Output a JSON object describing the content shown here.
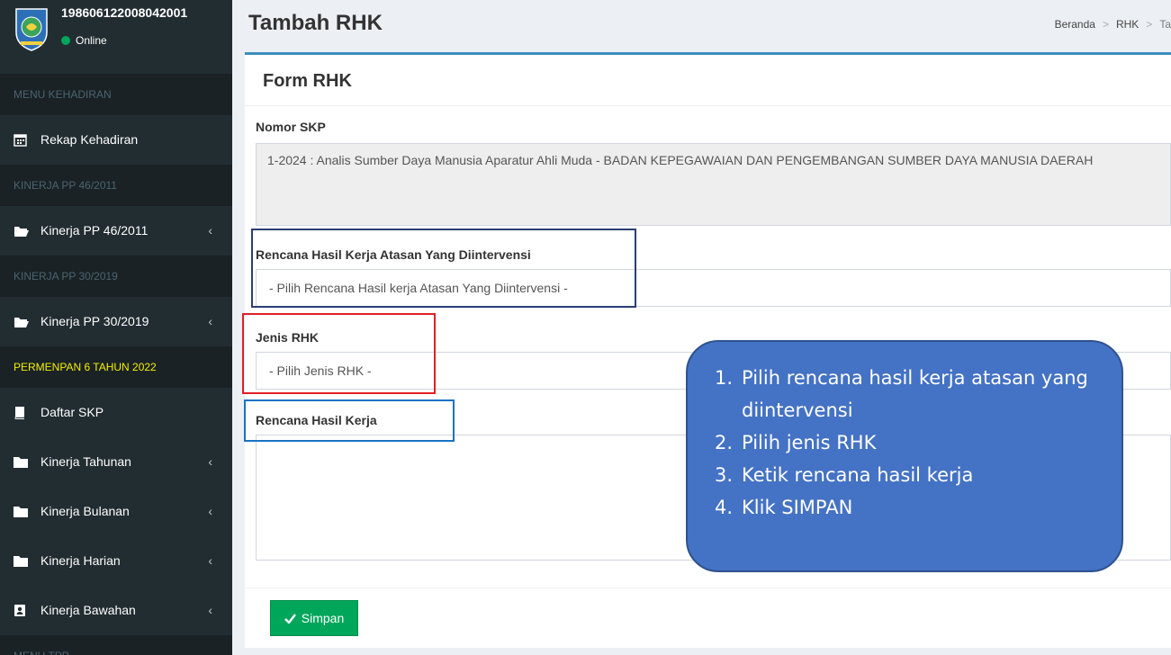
{
  "user": {
    "id": "198606122008042001",
    "status": "Online"
  },
  "sidebar": {
    "items": [
      {
        "type": "header",
        "label": "MENU KEHADIRAN"
      },
      {
        "type": "item",
        "label": "Rekap Kehadiran",
        "icon": "calendar-icon"
      },
      {
        "type": "header",
        "label": "KINERJA PP 46/2011"
      },
      {
        "type": "item",
        "label": "Kinerja PP 46/2011",
        "icon": "folder-open-icon",
        "chevron": "‹"
      },
      {
        "type": "header",
        "label": "KINERJA PP 30/2019"
      },
      {
        "type": "item",
        "label": "Kinerja PP 30/2019",
        "icon": "folder-open-icon",
        "chevron": "‹"
      },
      {
        "type": "header",
        "label": "PERMENPAN 6 TAHUN 2022"
      },
      {
        "type": "item",
        "label": "Daftar SKP",
        "icon": "book-icon"
      },
      {
        "type": "item",
        "label": "Kinerja Tahunan",
        "icon": "folder-icon",
        "chevron": "‹"
      },
      {
        "type": "item",
        "label": "Kinerja Bulanan",
        "icon": "folder-icon",
        "chevron": "‹"
      },
      {
        "type": "item",
        "label": "Kinerja Harian",
        "icon": "folder-icon",
        "chevron": "‹"
      },
      {
        "type": "item",
        "label": "Kinerja Bawahan",
        "icon": "contact-book-icon",
        "chevron": "‹"
      },
      {
        "type": "header",
        "label": "MENU TPP"
      }
    ]
  },
  "page": {
    "title": "Tambah RHK",
    "breadcrumb": [
      "Beranda",
      "RHK",
      "Ta"
    ]
  },
  "form": {
    "title": "Form RHK",
    "nomor_skp_label": "Nomor SKP",
    "nomor_skp_value": "1-2024 : Analis Sumber Daya Manusia Aparatur Ahli Muda - BADAN KEPEGAWAIAN DAN PENGEMBANGAN SUMBER DAYA MANUSIA DAERAH",
    "rhk_atasan_label": "Rencana Hasil Kerja Atasan Yang Diintervensi",
    "rhk_atasan_placeholder": "- Pilih Rencana Hasil kerja Atasan Yang Diintervensi -",
    "jenis_rhk_label": "Jenis RHK",
    "jenis_rhk_placeholder": "- Pilih Jenis RHK -",
    "rhk_label": "Rencana Hasil Kerja",
    "rhk_value": "",
    "save_label": "Simpan"
  },
  "callout": {
    "steps": [
      "Pilih rencana hasil kerja atasan yang diintervensi",
      "Pilih jenis RHK",
      "Ketik rencana hasil kerja",
      "Klik SIMPAN"
    ]
  },
  "colors": {
    "sidebar_bg": "#222d32",
    "accent": "#3c8dbc",
    "save_button": "#00a65a",
    "callout_bg": "#4472c4",
    "highlight_header": "#f3f000"
  }
}
